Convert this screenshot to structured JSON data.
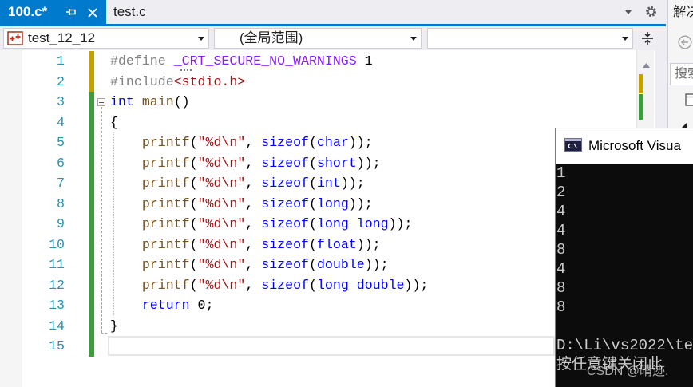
{
  "tabs": [
    {
      "label": "100.c*",
      "active": true,
      "pin_icon": "pin-icon",
      "close_icon": "close-icon"
    },
    {
      "label": "test.c",
      "active": false
    }
  ],
  "tab_strip": {
    "overflow_icon": "chevron-down-icon",
    "settings_icon": "gear-icon"
  },
  "nav_bar": {
    "project": {
      "value": "test_12_12",
      "icon": "cpp-project-icon"
    },
    "scope": {
      "value": "(全局范围)"
    },
    "split_icon": "split-editor-icon"
  },
  "editor": {
    "lines": [
      {
        "n": "1",
        "change": "#c4a000",
        "tokens": [
          {
            "t": "#define",
            "c": "#808080"
          },
          {
            "t": " "
          },
          {
            "t": "_CRT_SECURE_NO_WARNINGS",
            "c": "#8a1bff"
          },
          {
            "t": " 1"
          }
        ]
      },
      {
        "n": "2",
        "change": "#c4a000",
        "tokens": [
          {
            "t": "#include",
            "c": "#808080"
          },
          {
            "t": "<stdio.h>",
            "c": "#a31515"
          }
        ]
      },
      {
        "n": "3",
        "change": "#3a9f3a",
        "tokens": [
          {
            "t": "int",
            "c": "#0000ff"
          },
          {
            "t": " "
          },
          {
            "t": "main",
            "c": "#74531f"
          },
          {
            "t": "()"
          }
        ]
      },
      {
        "n": "4",
        "change": "#3a9f3a",
        "tokens": [
          {
            "t": "{"
          }
        ]
      },
      {
        "n": "5",
        "change": "#3a9f3a",
        "tokens": [
          {
            "t": "    "
          },
          {
            "t": "printf",
            "c": "#74531f"
          },
          {
            "t": "("
          },
          {
            "t": "\"%d\\n\"",
            "c": "#a31515"
          },
          {
            "t": ", "
          },
          {
            "t": "sizeof",
            "c": "#0000ff"
          },
          {
            "t": "("
          },
          {
            "t": "char",
            "c": "#0000ff"
          },
          {
            "t": "));"
          }
        ]
      },
      {
        "n": "6",
        "change": "#3a9f3a",
        "tokens": [
          {
            "t": "    "
          },
          {
            "t": "printf",
            "c": "#74531f"
          },
          {
            "t": "("
          },
          {
            "t": "\"%d\\n\"",
            "c": "#a31515"
          },
          {
            "t": ", "
          },
          {
            "t": "sizeof",
            "c": "#0000ff"
          },
          {
            "t": "("
          },
          {
            "t": "short",
            "c": "#0000ff"
          },
          {
            "t": "));"
          }
        ]
      },
      {
        "n": "7",
        "change": "#3a9f3a",
        "tokens": [
          {
            "t": "    "
          },
          {
            "t": "printf",
            "c": "#74531f"
          },
          {
            "t": "("
          },
          {
            "t": "\"%d\\n\"",
            "c": "#a31515"
          },
          {
            "t": ", "
          },
          {
            "t": "sizeof",
            "c": "#0000ff"
          },
          {
            "t": "("
          },
          {
            "t": "int",
            "c": "#0000ff"
          },
          {
            "t": "));"
          }
        ]
      },
      {
        "n": "8",
        "change": "#3a9f3a",
        "tokens": [
          {
            "t": "    "
          },
          {
            "t": "printf",
            "c": "#74531f"
          },
          {
            "t": "("
          },
          {
            "t": "\"%d\\n\"",
            "c": "#a31515"
          },
          {
            "t": ", "
          },
          {
            "t": "sizeof",
            "c": "#0000ff"
          },
          {
            "t": "("
          },
          {
            "t": "long",
            "c": "#0000ff"
          },
          {
            "t": "));"
          }
        ]
      },
      {
        "n": "9",
        "change": "#3a9f3a",
        "tokens": [
          {
            "t": "    "
          },
          {
            "t": "printf",
            "c": "#74531f"
          },
          {
            "t": "("
          },
          {
            "t": "\"%d\\n\"",
            "c": "#a31515"
          },
          {
            "t": ", "
          },
          {
            "t": "sizeof",
            "c": "#0000ff"
          },
          {
            "t": "("
          },
          {
            "t": "long long",
            "c": "#0000ff"
          },
          {
            "t": "));"
          }
        ]
      },
      {
        "n": "10",
        "change": "#3a9f3a",
        "tokens": [
          {
            "t": "    "
          },
          {
            "t": "printf",
            "c": "#74531f"
          },
          {
            "t": "("
          },
          {
            "t": "\"%d\\n\"",
            "c": "#a31515"
          },
          {
            "t": ", "
          },
          {
            "t": "sizeof",
            "c": "#0000ff"
          },
          {
            "t": "("
          },
          {
            "t": "float",
            "c": "#0000ff"
          },
          {
            "t": "));"
          }
        ]
      },
      {
        "n": "11",
        "change": "#3a9f3a",
        "tokens": [
          {
            "t": "    "
          },
          {
            "t": "printf",
            "c": "#74531f"
          },
          {
            "t": "("
          },
          {
            "t": "\"%d\\n\"",
            "c": "#a31515"
          },
          {
            "t": ", "
          },
          {
            "t": "sizeof",
            "c": "#0000ff"
          },
          {
            "t": "("
          },
          {
            "t": "double",
            "c": "#0000ff"
          },
          {
            "t": "));"
          }
        ]
      },
      {
        "n": "12",
        "change": "#3a9f3a",
        "tokens": [
          {
            "t": "    "
          },
          {
            "t": "printf",
            "c": "#74531f"
          },
          {
            "t": "("
          },
          {
            "t": "\"%d\\n\"",
            "c": "#a31515"
          },
          {
            "t": ", "
          },
          {
            "t": "sizeof",
            "c": "#0000ff"
          },
          {
            "t": "("
          },
          {
            "t": "long double",
            "c": "#0000ff"
          },
          {
            "t": "));"
          }
        ]
      },
      {
        "n": "13",
        "change": "#3a9f3a",
        "tokens": [
          {
            "t": "    "
          },
          {
            "t": "return",
            "c": "#0000ff"
          },
          {
            "t": " 0;"
          }
        ]
      },
      {
        "n": "14",
        "change": "#3a9f3a",
        "tokens": [
          {
            "t": "}"
          }
        ]
      },
      {
        "n": "15",
        "change": "#3a9f3a",
        "tokens": []
      }
    ],
    "scroll_markers": {
      "unsaved": "#c4a000",
      "saved": "#3a9f3a"
    }
  },
  "solution_explorer": {
    "title": "解决",
    "search_placeholder": "搜索",
    "back_icon": "back-icon",
    "view_icon": "document-icon"
  },
  "console": {
    "icon": "console-icon",
    "title": "Microsoft Visua",
    "lines": [
      "1",
      "2",
      "4",
      "4",
      "8",
      "4",
      "8",
      "8",
      "",
      "D:\\Li\\vs2022\\te",
      "按任意键关闭此"
    ]
  },
  "watermark": "CSDN @晴迹.",
  "colors": {
    "accent": "#007acc",
    "line_number": "#2b91af",
    "console_bg": "#0c0c0c"
  }
}
